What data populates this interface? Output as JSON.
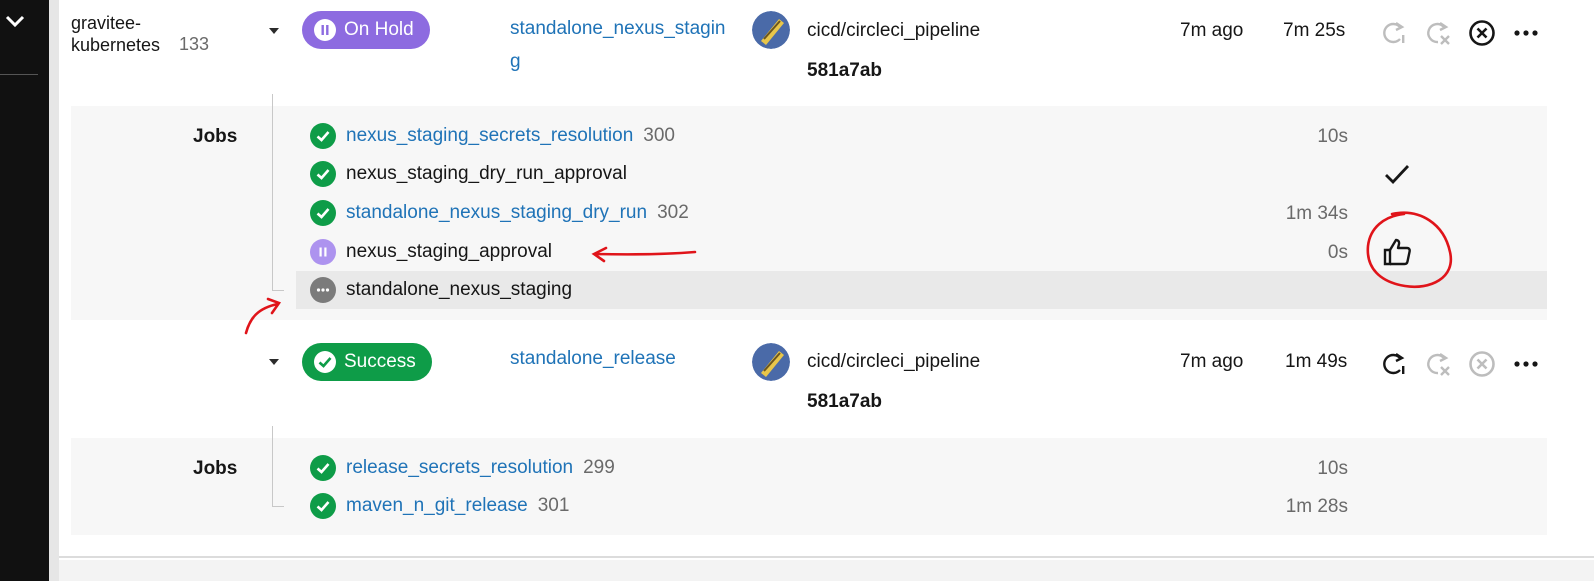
{
  "project": {
    "name": "gravitee-kubernetes",
    "number": "133"
  },
  "workflows": [
    {
      "status": "On Hold",
      "name": "standalone_nexus_staging",
      "trigger": "cicd/circleci_pipeline",
      "commit": "581a7ab",
      "started": "7m ago",
      "duration": "7m 25s",
      "jobs_label": "Jobs",
      "jobs": [
        {
          "name": "nexus_staging_secrets_resolution",
          "number": "300",
          "duration": "10s",
          "status": "success",
          "link": true
        },
        {
          "name": "nexus_staging_dry_run_approval",
          "number": "",
          "duration": "",
          "status": "approved",
          "link": false
        },
        {
          "name": "standalone_nexus_staging_dry_run",
          "number": "302",
          "duration": "1m 34s",
          "status": "success",
          "link": true
        },
        {
          "name": "nexus_staging_approval",
          "number": "",
          "duration": "0s",
          "status": "on-hold",
          "link": false
        },
        {
          "name": "standalone_nexus_staging",
          "number": "",
          "duration": "",
          "status": "pending",
          "link": false
        }
      ]
    },
    {
      "status": "Success",
      "name": "standalone_release",
      "trigger": "cicd/circleci_pipeline",
      "commit": "581a7ab",
      "started": "7m ago",
      "duration": "1m 49s",
      "jobs_label": "Jobs",
      "jobs": [
        {
          "name": "release_secrets_resolution",
          "number": "299",
          "duration": "10s",
          "status": "success",
          "link": true
        },
        {
          "name": "maven_n_git_release",
          "number": "301",
          "duration": "1m 28s",
          "status": "success",
          "link": true
        }
      ]
    }
  ],
  "colors": {
    "link": "#1f73b7",
    "success": "#0e9c48",
    "on_hold": "#8d6be0",
    "annotation": "#e0141a"
  },
  "icons": [
    "chevron-down-icon",
    "rerun-icon",
    "rerun-failed-icon",
    "cancel-icon",
    "more-icon",
    "check-icon",
    "thumbs-up-icon",
    "pause-icon",
    "ellipsis-icon"
  ]
}
